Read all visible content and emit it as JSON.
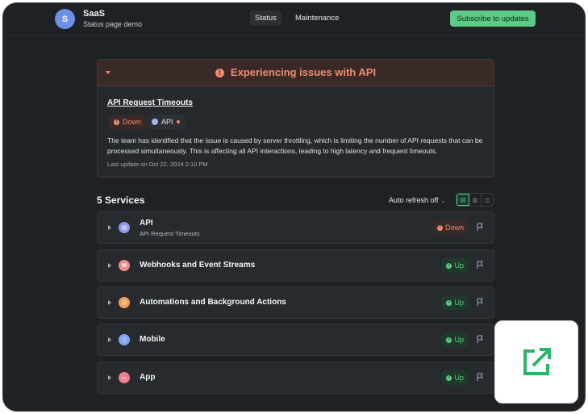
{
  "header": {
    "avatar_letter": "S",
    "brand_name": "SaaS",
    "brand_subtitle": "Status page demo",
    "tabs": [
      {
        "label": "Status",
        "active": true
      },
      {
        "label": "Maintenance",
        "active": false
      }
    ],
    "subscribe_label": "Subscribe to updates"
  },
  "incident": {
    "banner_title": "Experiencing issues with API",
    "title": "API Request Timeouts",
    "status_badge": "Down",
    "component_badge": "API",
    "description": "The team has identified that the issue is caused by server throttling, which is limiting the number of API requests that can be processed simultaneously. This is affecting all API interactions, leading to high latency and frequent timeouts.",
    "last_update": "Last update on Oct 22, 2024 2:10 PM"
  },
  "services": {
    "heading": "5 Services",
    "auto_refresh_label": "Auto refresh off",
    "items": [
      {
        "name": "API",
        "subtitle": "API Request Timeouts",
        "status": "Down",
        "icon": "api-icon",
        "icon_color": "#8f9be8",
        "icon_glyph": "▤"
      },
      {
        "name": "Webhooks and Event Streams",
        "subtitle": "",
        "status": "Up",
        "icon": "webhook-icon",
        "icon_color": "#f08b8b",
        "icon_glyph": "M"
      },
      {
        "name": "Automations and Background Actions",
        "subtitle": "",
        "status": "Up",
        "icon": "automation-icon",
        "icon_color": "#f0a05a",
        "icon_glyph": "◎"
      },
      {
        "name": "Mobile",
        "subtitle": "",
        "status": "Up",
        "icon": "mobile-icon",
        "icon_color": "#7fa7ef",
        "icon_glyph": "▯"
      },
      {
        "name": "App",
        "subtitle": "",
        "status": "Up",
        "icon": "app-icon",
        "icon_color": "#f07f8a",
        "icon_glyph": "▭"
      }
    ]
  },
  "colors": {
    "background": "#1f2225",
    "accent_green": "#5dcb85",
    "alert_red": "#f08b72"
  }
}
